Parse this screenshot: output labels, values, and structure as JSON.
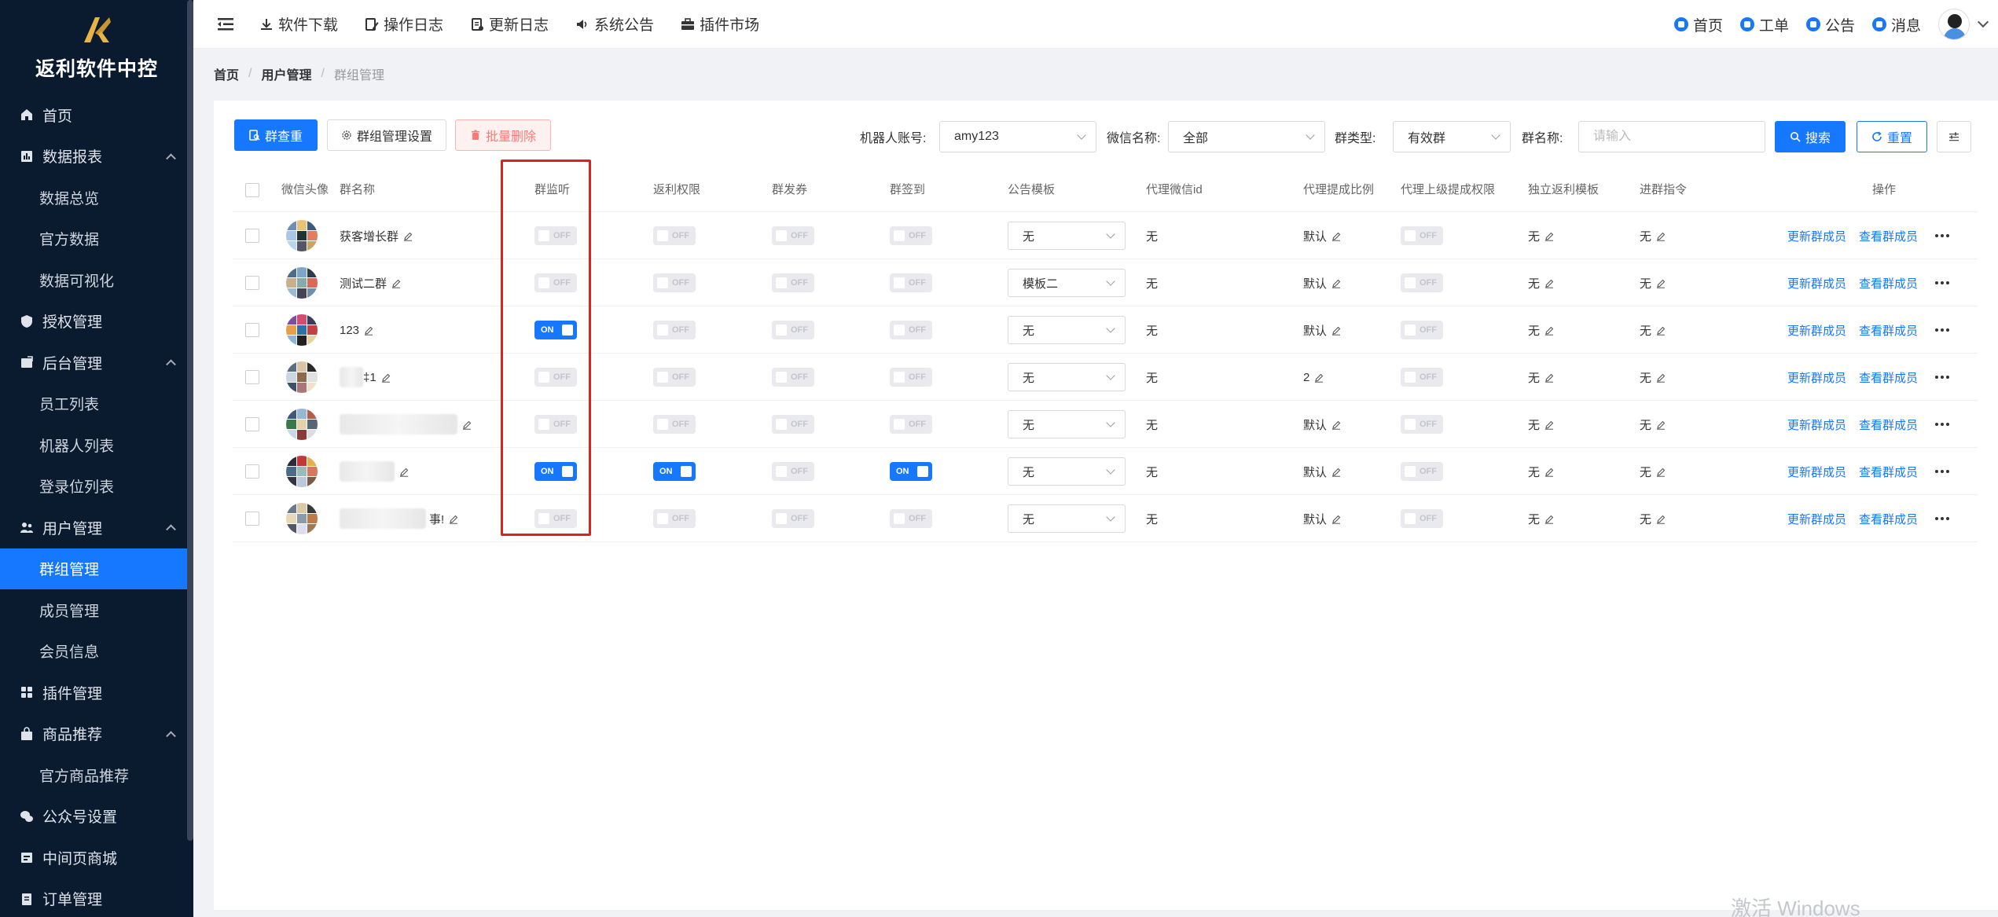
{
  "brand": {
    "title": "返利软件中控"
  },
  "sidebar": {
    "items": [
      {
        "label": "首页",
        "icon": "home-icon",
        "type": "top"
      },
      {
        "label": "数据报表",
        "icon": "report-icon",
        "type": "group"
      },
      {
        "label": "数据总览",
        "type": "sub"
      },
      {
        "label": "官方数据",
        "type": "sub"
      },
      {
        "label": "数据可视化",
        "type": "sub"
      },
      {
        "label": "授权管理",
        "icon": "shield-icon",
        "type": "top"
      },
      {
        "label": "后台管理",
        "icon": "admin-icon",
        "type": "group"
      },
      {
        "label": "员工列表",
        "type": "sub"
      },
      {
        "label": "机器人列表",
        "type": "sub"
      },
      {
        "label": "登录位列表",
        "type": "sub"
      },
      {
        "label": "用户管理",
        "icon": "users-icon",
        "type": "group"
      },
      {
        "label": "群组管理",
        "type": "sub",
        "active": true
      },
      {
        "label": "成员管理",
        "type": "sub"
      },
      {
        "label": "会员信息",
        "type": "sub"
      },
      {
        "label": "插件管理",
        "icon": "grid-icon",
        "type": "top"
      },
      {
        "label": "商品推荐",
        "icon": "bag-icon",
        "type": "group"
      },
      {
        "label": "官方商品推荐",
        "type": "sub"
      },
      {
        "label": "公众号设置",
        "icon": "wechat-icon",
        "type": "top"
      },
      {
        "label": "中间页商城",
        "icon": "store-icon",
        "type": "top"
      },
      {
        "label": "订单管理",
        "icon": "order-icon",
        "type": "top"
      }
    ]
  },
  "header": {
    "nav": [
      "软件下载",
      "操作日志",
      "更新日志",
      "系统公告",
      "插件市场"
    ],
    "right": [
      "首页",
      "工单",
      "公告",
      "消息"
    ]
  },
  "breadcrumb": {
    "home": "首页",
    "section": "用户管理",
    "current": "群组管理"
  },
  "toolbar": {
    "check_label": "群查重",
    "settings_label": "群组管理设置",
    "delete_label": "批量删除",
    "robot_label": "机器人账号:",
    "robot_value": "amy123",
    "wechat_label": "微信名称:",
    "wechat_value": "全部",
    "type_label": "群类型:",
    "type_value": "有效群",
    "name_label": "群名称:",
    "name_placeholder": "请输入",
    "search_label": "搜索",
    "reset_label": "重置"
  },
  "table": {
    "headers": [
      "微信头像",
      "群名称",
      "群监听",
      "返利权限",
      "群发券",
      "群签到",
      "公告模板",
      "代理微信id",
      "代理提成比例",
      "代理上级提成权限",
      "独立返利模板",
      "进群指令",
      "操作"
    ],
    "switch_on": "ON",
    "switch_off": "OFF",
    "action_update": "更新群成员",
    "action_view": "查看群成员",
    "rows": [
      {
        "name": "获客增长群",
        "name_blur": 0,
        "monitor": false,
        "rebate": false,
        "coupon": false,
        "signin": false,
        "template": "无",
        "agent_id": "无",
        "ratio": "默认",
        "upper": false,
        "rebate_tpl": "无",
        "cmd": "无"
      },
      {
        "name": "测试二群",
        "name_blur": 0,
        "monitor": false,
        "rebate": false,
        "coupon": false,
        "signin": false,
        "template": "模板二",
        "agent_id": "无",
        "ratio": "默认",
        "upper": false,
        "rebate_tpl": "无",
        "cmd": "无"
      },
      {
        "name": "123",
        "name_blur": 0,
        "monitor": true,
        "rebate": false,
        "coupon": false,
        "signin": false,
        "template": "无",
        "agent_id": "无",
        "ratio": "默认",
        "upper": false,
        "rebate_tpl": "无",
        "cmd": "无"
      },
      {
        "name": "‡1",
        "name_blur": 1,
        "monitor": false,
        "rebate": false,
        "coupon": false,
        "signin": false,
        "template": "无",
        "agent_id": "无",
        "ratio": "2",
        "upper": false,
        "rebate_tpl": "无",
        "cmd": "无"
      },
      {
        "name": "",
        "name_blur": 2,
        "monitor": false,
        "rebate": false,
        "coupon": false,
        "signin": false,
        "template": "无",
        "agent_id": "无",
        "ratio": "默认",
        "upper": false,
        "rebate_tpl": "无",
        "cmd": "无"
      },
      {
        "name": "",
        "name_blur": 3,
        "monitor": true,
        "rebate": true,
        "coupon": false,
        "signin": true,
        "template": "无",
        "agent_id": "无",
        "ratio": "默认",
        "upper": false,
        "rebate_tpl": "无",
        "cmd": "无"
      },
      {
        "name": "事!",
        "name_blur": 4,
        "monitor": false,
        "rebate": false,
        "coupon": false,
        "signin": false,
        "template": "无",
        "agent_id": "无",
        "ratio": "默认",
        "upper": false,
        "rebate_tpl": "无",
        "cmd": "无"
      }
    ]
  },
  "watermark": "激活 Windows",
  "colors": {
    "primary": "#1677ff",
    "sidebar": "#0a1a2f",
    "highlight": "#e0201b"
  }
}
